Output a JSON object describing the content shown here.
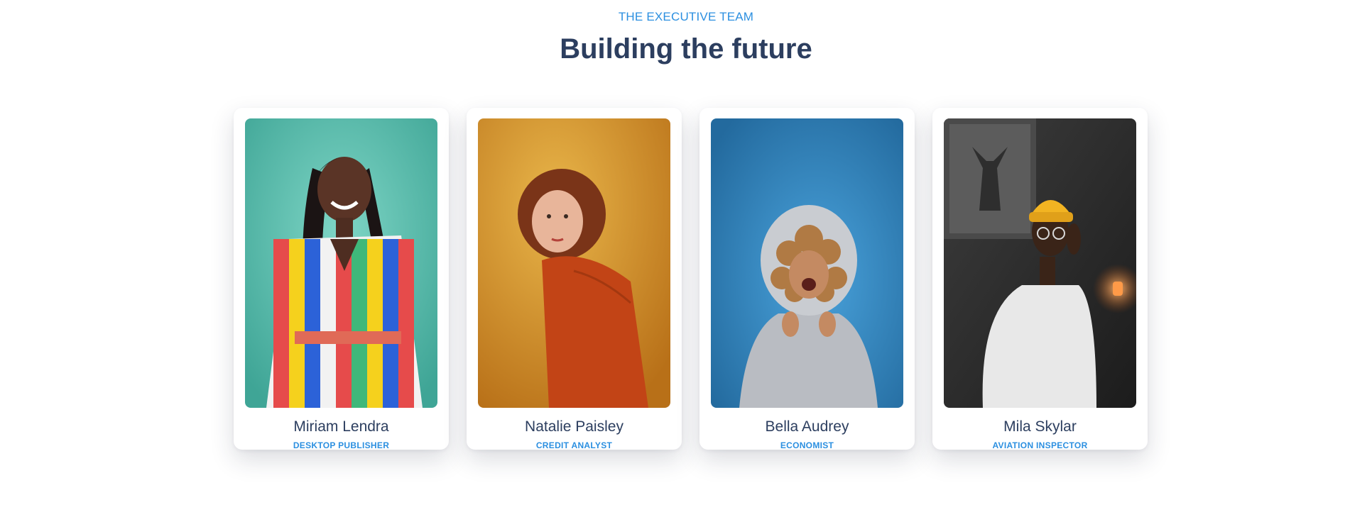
{
  "section": {
    "eyebrow": "THE EXECUTIVE TEAM",
    "title": "Building the future"
  },
  "colors": {
    "accent": "#2b8fe0",
    "heading": "#2c3e5f"
  },
  "team": [
    {
      "name": "Miriam Lendra",
      "role": "DESKTOP PUBLISHER",
      "photo_background": "#5fc2b2"
    },
    {
      "name": "Natalie Paisley",
      "role": "CREDIT ANALYST",
      "photo_background": "#d69a2e"
    },
    {
      "name": "Bella Audrey",
      "role": "ECONOMIST",
      "photo_background": "#2f7fb8"
    },
    {
      "name": "Mila Skylar",
      "role": "AVIATION INSPECTOR",
      "photo_background": "#2b2b2b"
    }
  ]
}
